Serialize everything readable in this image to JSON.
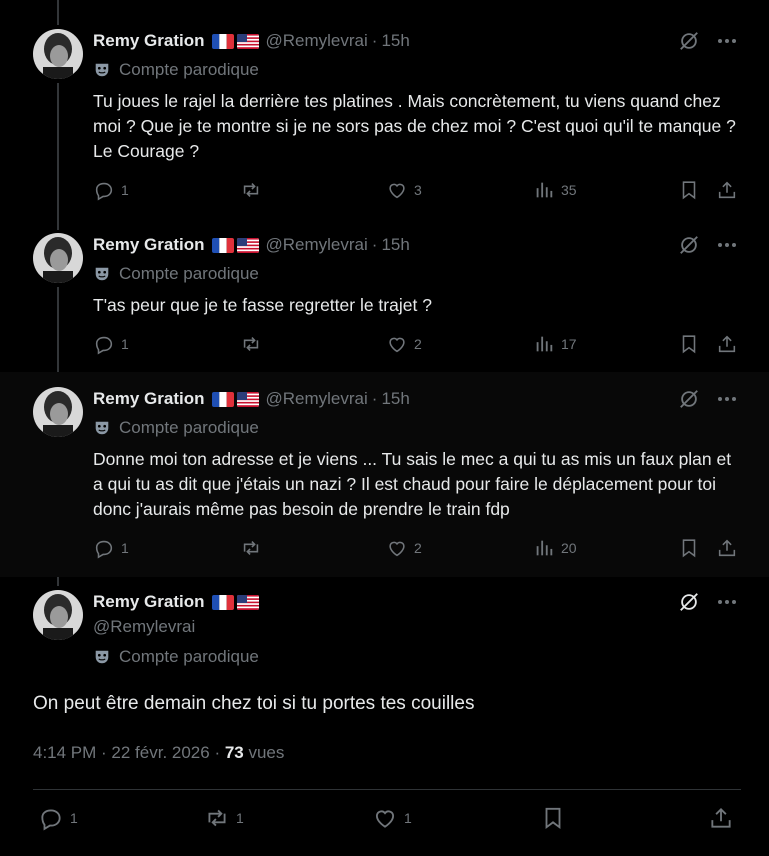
{
  "tweets": [
    {
      "name": "Remy Gration",
      "handle": "@Remylevrai",
      "dot": "·",
      "time": "15h",
      "label": "Compte parodique",
      "text": "Tu joues le rajel la derrière tes platines . Mais concrètement, tu viens quand chez moi ? Que je te montre si je ne sors pas de chez moi ? C'est quoi qu'il te manque ? Le Courage ?",
      "replies": "1",
      "reposts": "",
      "likes": "3",
      "views": "35"
    },
    {
      "name": "Remy Gration",
      "handle": "@Remylevrai",
      "dot": "·",
      "time": "15h",
      "label": "Compte parodique",
      "text": "T'as peur que je te fasse regretter le trajet ?",
      "replies": "1",
      "reposts": "",
      "likes": "2",
      "views": "17"
    },
    {
      "name": "Remy Gration",
      "handle": "@Remylevrai",
      "dot": "·",
      "time": "15h",
      "label": "Compte parodique",
      "text": "Donne moi ton adresse et je viens ... Tu sais le mec a qui tu as mis un faux plan et a qui tu as dit que j'étais un nazi ? Il est chaud pour faire le déplacement pour toi donc j'aurais même pas besoin de prendre le train fdp",
      "replies": "1",
      "reposts": "",
      "likes": "2",
      "views": "20"
    }
  ],
  "main": {
    "name": "Remy Gration",
    "handle": "@Remylevrai",
    "label": "Compte parodique",
    "text": "On peut être demain chez toi si tu portes tes couilles",
    "timestamp": "4:14 PM · 22 févr. 2026 · ",
    "views_count": "73",
    "views_label": " vues",
    "replies": "1",
    "reposts": "1",
    "likes": "1"
  },
  "colors": {
    "background": "#000000",
    "text": "#e7e9ea",
    "muted": "#71767b",
    "border": "#2f3336"
  },
  "icons": [
    "grok-icon",
    "more-icon",
    "parody-mask-icon",
    "reply-icon",
    "repost-icon",
    "like-icon",
    "views-icon",
    "bookmark-icon",
    "share-icon",
    "flag-fr-icon",
    "flag-us-icon"
  ]
}
